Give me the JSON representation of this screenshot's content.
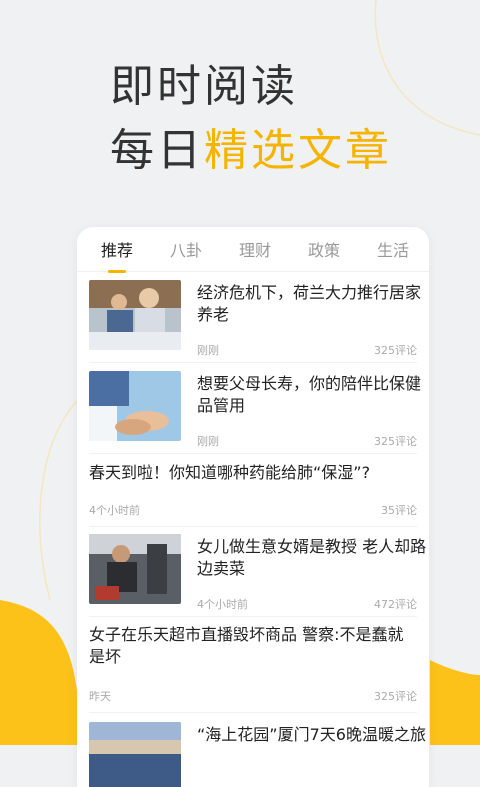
{
  "hero": {
    "line1": "即时阅读",
    "line2_prefix": "每日",
    "line2_accent": "精选文章"
  },
  "tabs": [
    "推荐",
    "八卦",
    "理财",
    "政策",
    "生活"
  ],
  "articles": [
    {
      "title": "经济危机下，荷兰大力推行居家养老",
      "time": "刚刚",
      "comments": "325评论",
      "thumb": "elderly-couple-photo"
    },
    {
      "title": "想要父母长寿，你的陪伴比保健品管用",
      "time": "刚刚",
      "comments": "325评论",
      "thumb": "holding-hands-photo"
    },
    {
      "title": "春天到啦！你知道哪种药能给肺“保湿”?",
      "time": "4个小时前",
      "comments": "35评论"
    },
    {
      "title": "女儿做生意女婿是教授 老人却路边卖菜",
      "time": "4个小时前",
      "comments": "472评论",
      "thumb": "street-vendor-photo"
    },
    {
      "title": "女子在乐天超市直播毁坏商品 警察:不是蠢就是坏",
      "time": "昨天",
      "comments": "325评论"
    },
    {
      "title": "“海上花园”厦门7天6晚温暖之旅",
      "thumb": "sea-sky-photo"
    }
  ],
  "colors": {
    "accent": "#f5b400",
    "background": "#f0f1f3"
  }
}
